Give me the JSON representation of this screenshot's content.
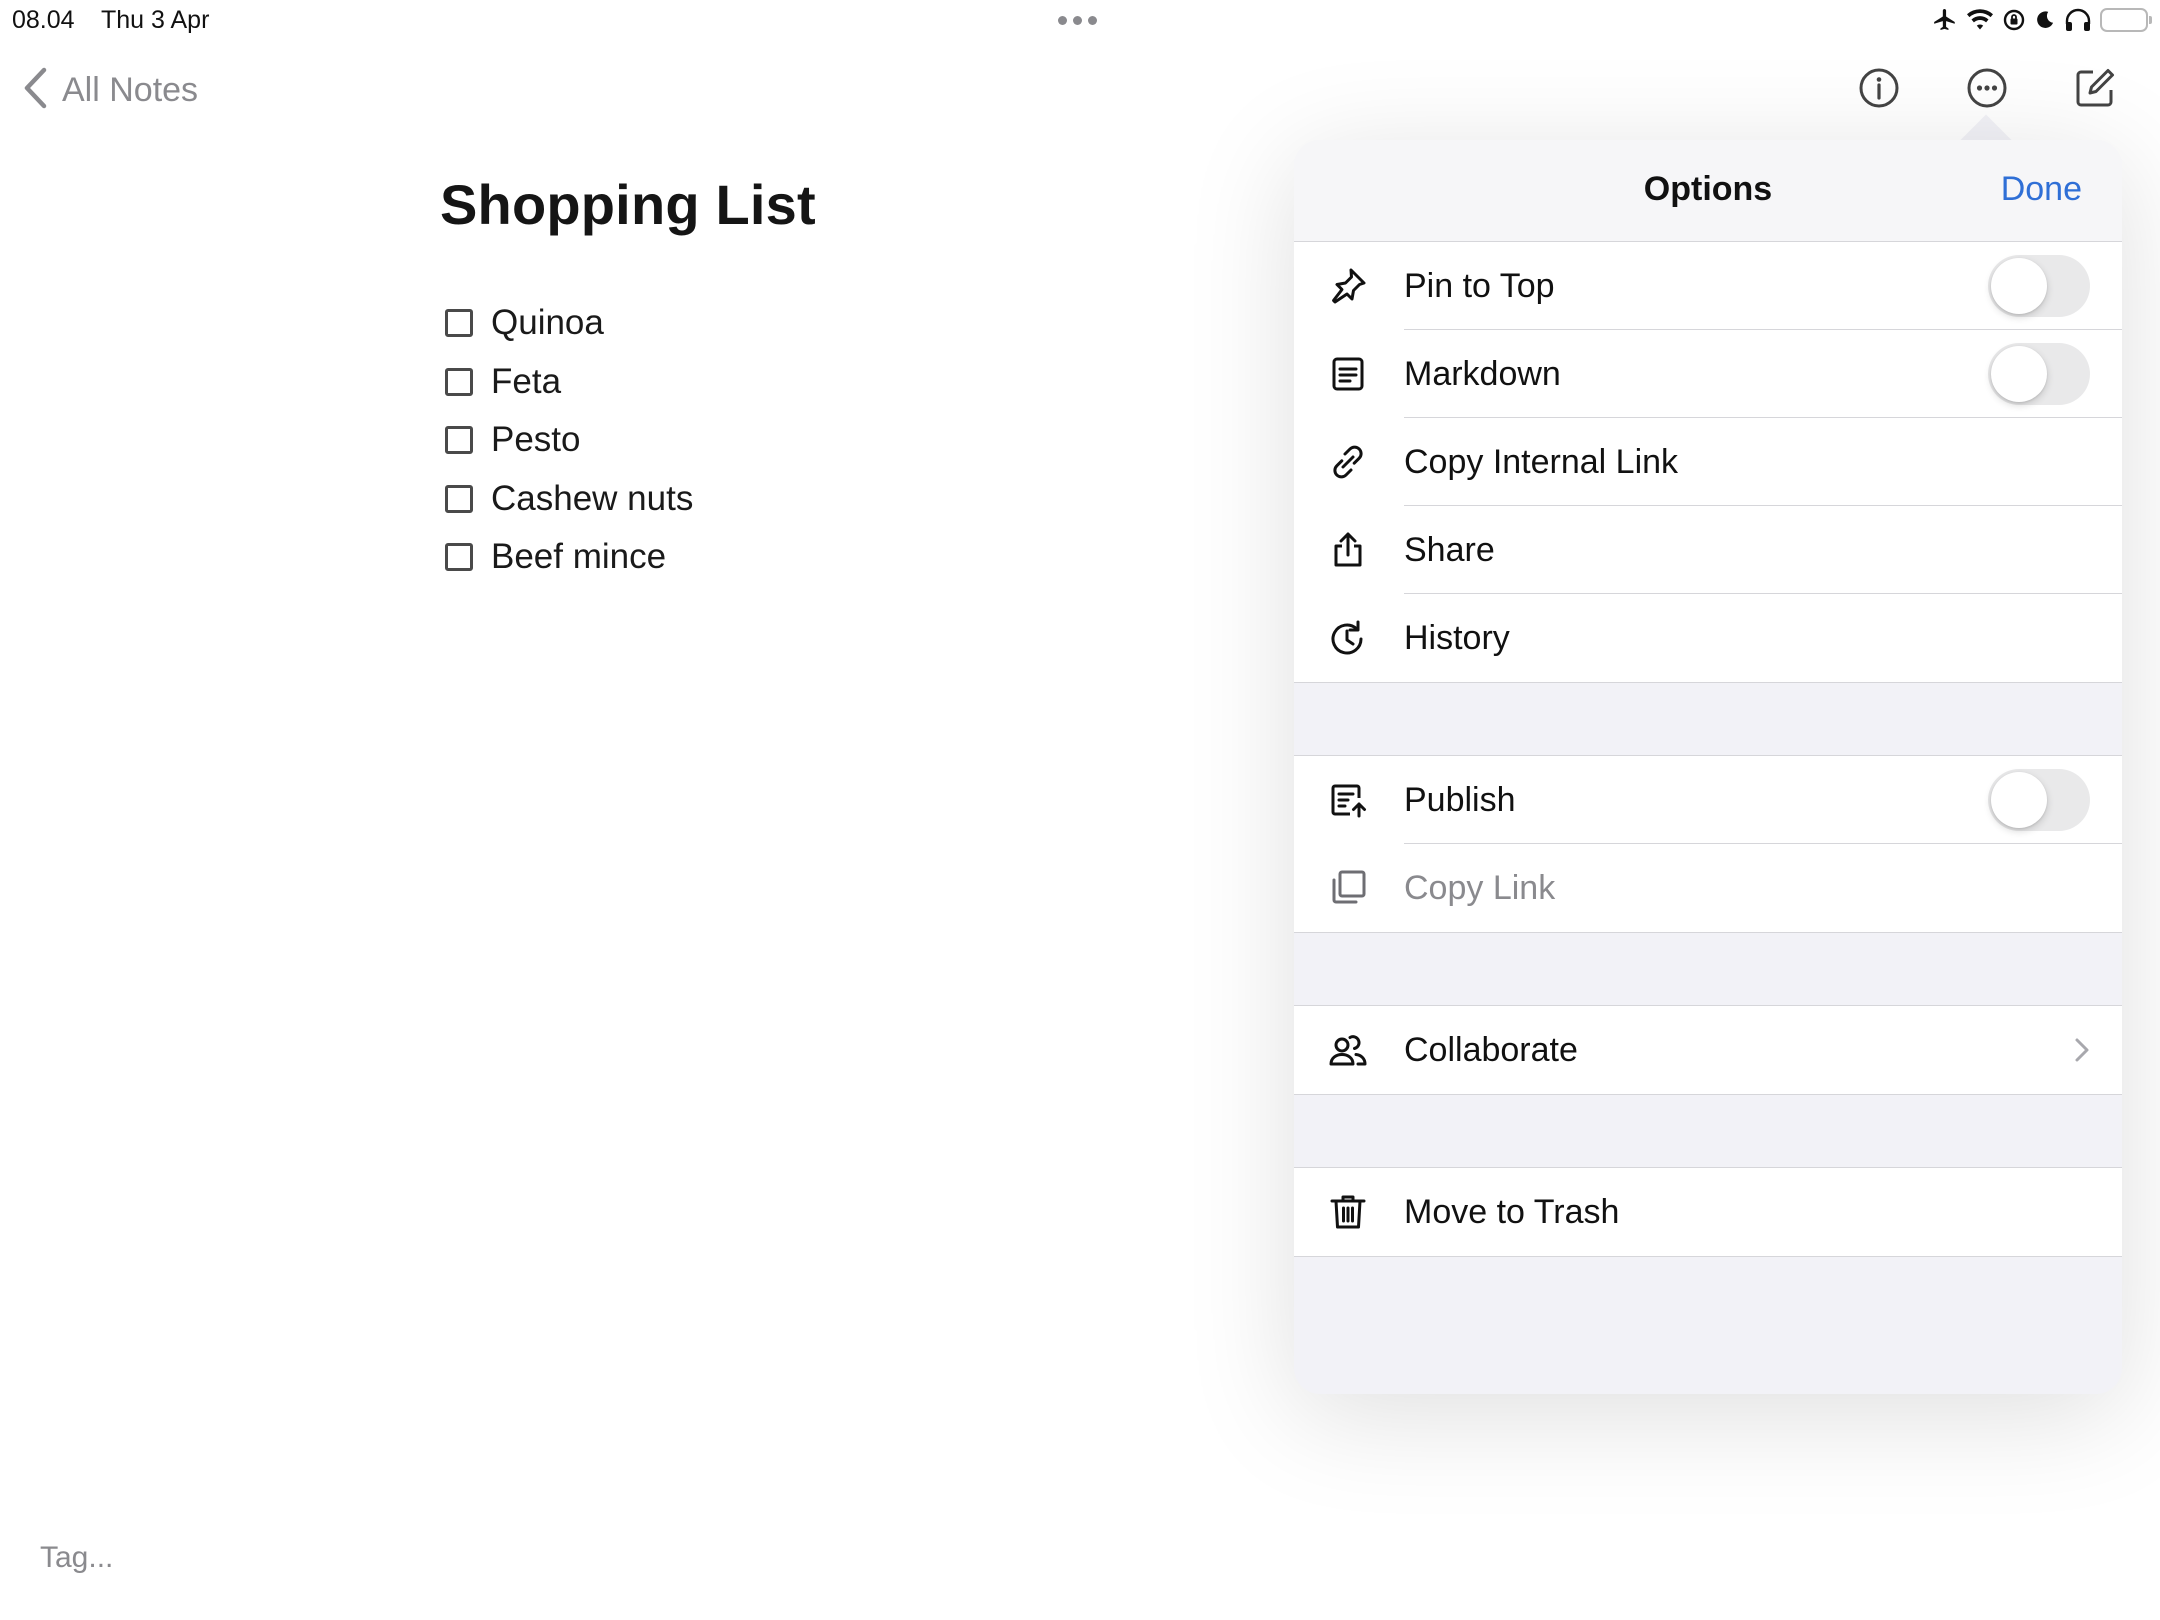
{
  "status_bar": {
    "time": "08.04",
    "date": "Thu 3 Apr",
    "icons": [
      "airplane-icon",
      "wifi-icon",
      "orientation-lock-icon",
      "moon-icon",
      "headphones-icon",
      "battery-icon"
    ],
    "battery_level": 0.95,
    "battery_color": "#f5c518"
  },
  "nav": {
    "back_label": "All Notes",
    "icons": [
      "info-icon",
      "more-icon",
      "compose-icon"
    ]
  },
  "note": {
    "title": "Shopping List",
    "items": [
      "Quinoa",
      "Feta",
      "Pesto",
      "Cashew nuts",
      "Beef mince"
    ],
    "tag_placeholder": "Tag..."
  },
  "options": {
    "title": "Options",
    "done_label": "Done",
    "accent_color": "#2f6fd6",
    "groups": [
      {
        "rows": [
          {
            "icon": "pin-icon",
            "label": "Pin to Top",
            "control": "toggle",
            "on": false
          },
          {
            "icon": "markdown-icon",
            "label": "Markdown",
            "control": "toggle",
            "on": false
          },
          {
            "icon": "link-icon",
            "label": "Copy Internal Link",
            "control": "none"
          },
          {
            "icon": "share-icon",
            "label": "Share",
            "control": "none"
          },
          {
            "icon": "history-icon",
            "label": "History",
            "control": "none"
          }
        ]
      },
      {
        "rows": [
          {
            "icon": "publish-icon",
            "label": "Publish",
            "control": "toggle",
            "on": false
          },
          {
            "icon": "copy-icon",
            "label": "Copy Link",
            "control": "none",
            "disabled": true
          }
        ]
      },
      {
        "rows": [
          {
            "icon": "collaborate-icon",
            "label": "Collaborate",
            "control": "chevron"
          }
        ]
      },
      {
        "rows": [
          {
            "icon": "trash-icon",
            "label": "Move to Trash",
            "control": "none"
          }
        ]
      }
    ]
  }
}
